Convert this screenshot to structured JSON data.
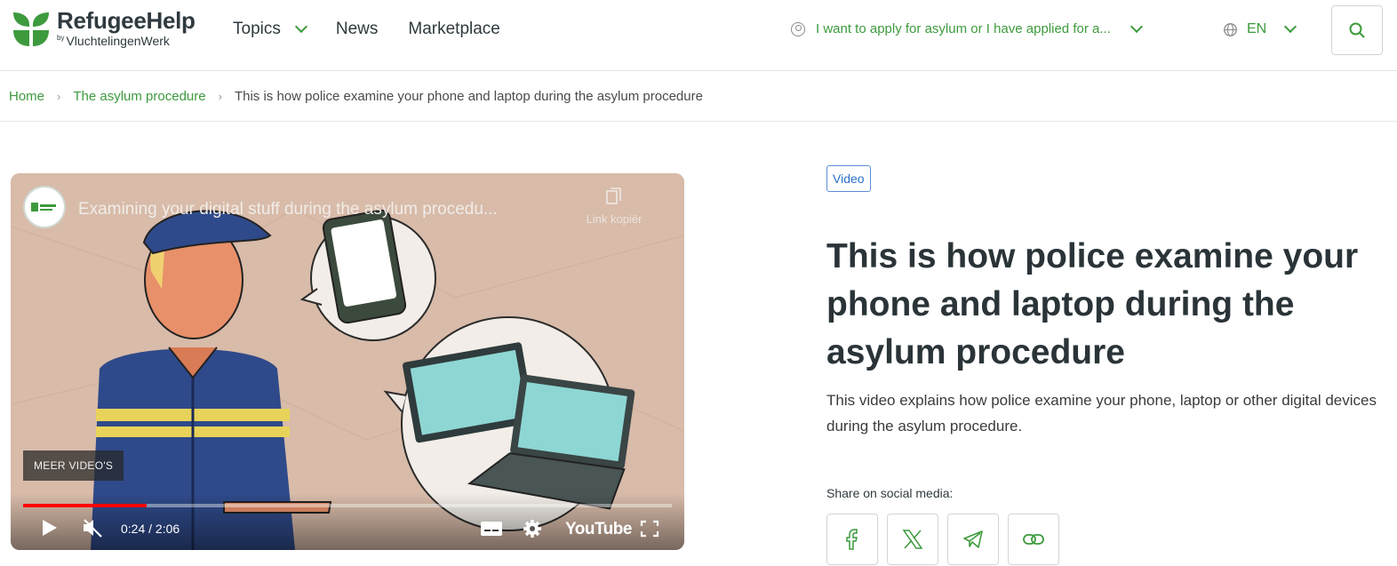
{
  "brand": {
    "name": "RefugeeHelp",
    "by": "by",
    "sub": "VluchtelingenWerk",
    "green": "#3d9a3d"
  },
  "nav": {
    "items": [
      {
        "label": "Topics",
        "has_dropdown": true
      },
      {
        "label": "News"
      },
      {
        "label": "Marketplace"
      }
    ]
  },
  "audience": {
    "label": "I want to apply for asylum or I have applied for a..."
  },
  "language": {
    "label": "EN"
  },
  "search": {
    "icon": "search-icon"
  },
  "breadcrumb": {
    "home": "Home",
    "section": "The asylum procedure",
    "current": "This is how police examine your phone and laptop during the asylum procedure"
  },
  "video": {
    "title": "Examining your digital stuff during the asylum procedu...",
    "copy_label": "Link kopiër",
    "more_videos": "MEER VIDEO'S",
    "time": "0:24 / 2:06",
    "progress": 0.19,
    "youtube_label": "YouTube"
  },
  "article": {
    "tag": "Video",
    "title": "This is how police examine your phone and laptop during the asylum procedure",
    "description": "This video explains how police examine your phone, laptop or other digital devices during the asylum procedure.",
    "share_label": "Share on social media:",
    "share_buttons": [
      "facebook-icon",
      "x-icon",
      "telegram-icon",
      "link-icon"
    ]
  }
}
